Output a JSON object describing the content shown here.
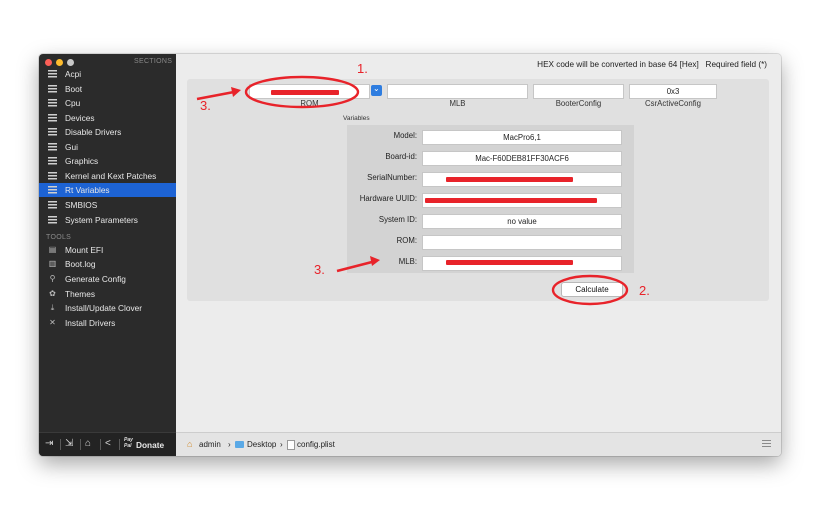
{
  "sidebar": {
    "sections_label": "SECTIONS",
    "items": [
      {
        "label": "Acpi",
        "icon": "list-icon"
      },
      {
        "label": "Boot",
        "icon": "list-icon"
      },
      {
        "label": "Cpu",
        "icon": "list-icon"
      },
      {
        "label": "Devices",
        "icon": "list-icon"
      },
      {
        "label": "Disable Drivers",
        "icon": "list-icon"
      },
      {
        "label": "Gui",
        "icon": "list-icon"
      },
      {
        "label": "Graphics",
        "icon": "list-icon"
      },
      {
        "label": "Kernel and Kext Patches",
        "icon": "list-icon"
      },
      {
        "label": "Rt Variables",
        "icon": "list-icon",
        "selected": true
      },
      {
        "label": "SMBIOS",
        "icon": "list-icon"
      },
      {
        "label": "System Parameters",
        "icon": "list-icon"
      }
    ],
    "tools_label": "TOOLS",
    "tools": [
      {
        "label": "Mount EFI",
        "icon": "disk-icon"
      },
      {
        "label": "Boot.log",
        "icon": "document-icon"
      },
      {
        "label": "Generate Config",
        "icon": "magnifier-icon"
      },
      {
        "label": "Themes",
        "icon": "palette-icon"
      },
      {
        "label": "Install/Update Clover",
        "icon": "download-icon"
      },
      {
        "label": "Install Drivers",
        "icon": "wrench-icon"
      }
    ],
    "bottom": {
      "pay_line1": "Pay",
      "pay_line2": "Pal",
      "donate_label": "Donate"
    }
  },
  "header": {
    "hex_note": "HEX code will be converted in base 64 [Hex]   Required field (*)"
  },
  "top_fields": {
    "rom": {
      "label": "ROM",
      "value": ""
    },
    "mlb": {
      "label": "MLB",
      "value": ""
    },
    "booter_config": {
      "label": "BooterConfig",
      "value": ""
    },
    "csr_active_config": {
      "label": "CsrActiveConfig",
      "value": "0x3"
    }
  },
  "variables": {
    "title": "Variables",
    "rows": [
      {
        "label": "Model:",
        "value": "MacPro6,1"
      },
      {
        "label": "Board-id:",
        "value": "Mac-F60DEB81FF30ACF6"
      },
      {
        "label": "SerialNumber:",
        "value": ""
      },
      {
        "label": "Hardware UUID:",
        "value": ""
      },
      {
        "label": "System ID:",
        "value": "no value"
      },
      {
        "label": "ROM:",
        "value": ""
      },
      {
        "label": "MLB:",
        "value": ""
      }
    ]
  },
  "calculate_label": "Calculate",
  "statusbar": {
    "crumbs": [
      "admin",
      "Desktop",
      "config.plist"
    ],
    "separator": "›"
  },
  "annotations": {
    "step1": "1.",
    "step2": "2.",
    "step3a": "3.",
    "step3b": "3.",
    "color": "#e8232a"
  },
  "colors": {
    "sidebar_bg": "#2b2b2b",
    "selection": "#1d63d4",
    "annotation_red": "#e8232a"
  }
}
